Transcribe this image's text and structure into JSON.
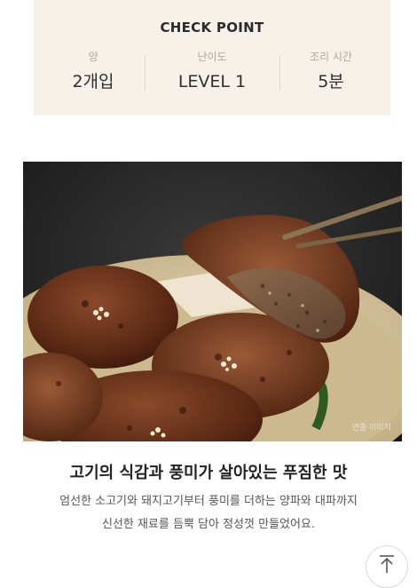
{
  "checkpoint": {
    "title": "CHECK POINT",
    "items": [
      {
        "label": "양",
        "value": "2개입"
      },
      {
        "label": "난이도",
        "value": "LEVEL 1"
      },
      {
        "label": "조리 시간",
        "value": "5분"
      }
    ]
  },
  "photo": {
    "caption": "연출 이미지"
  },
  "content": {
    "headline": "고기의 식감과 풍미가 살아있는 푸짐한 맛",
    "description_lines": [
      "엄선한 소고기와 돼지고기부터 풍미를 더하는 양파와 대파까지",
      "신선한 재료를 듬뿍 담아 정성껏 만들었어요."
    ]
  },
  "colors": {
    "checkpoint_bg": "#f7f1ea",
    "text_dark": "#222222",
    "text_muted": "#b0a89f"
  },
  "icons": {
    "scroll_top": "arrow-up-to-line-icon"
  }
}
